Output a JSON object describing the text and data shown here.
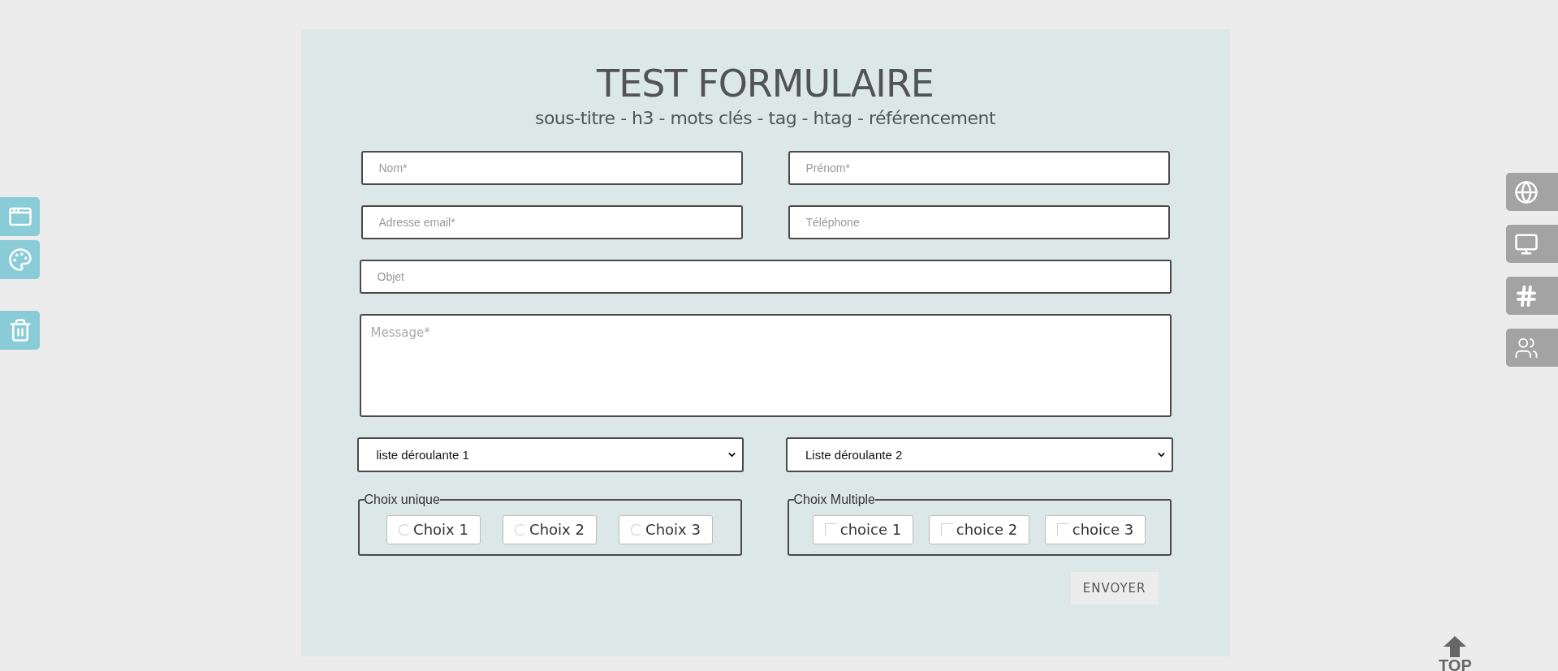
{
  "header": {
    "title": "TEST FORMULAIRE",
    "subtitle": "sous-titre - h3 - mots clés - tag - htag - référencement"
  },
  "field_rows": [
    [
      {
        "placeholder": "Nom*"
      },
      {
        "placeholder": "Prénom*"
      }
    ],
    [
      {
        "placeholder": "Adresse email*"
      },
      {
        "placeholder": "Téléphone"
      }
    ],
    [
      {
        "placeholder": "Objet"
      }
    ]
  ],
  "message": {
    "placeholder": "Message*"
  },
  "selects": [
    {
      "value": "liste déroulante 1"
    },
    {
      "value": "Liste déroulante 2"
    }
  ],
  "groups": [
    {
      "legend": "Choix unique",
      "kind": "radio",
      "options": [
        {
          "label": "Choix 1",
          "checked": false
        },
        {
          "label": "Choix 2",
          "checked": false
        },
        {
          "label": "Choix 3",
          "checked": false
        }
      ]
    },
    {
      "legend": "Choix Multiple",
      "kind": "checkbox",
      "options": [
        {
          "label": "choice 1",
          "checked": false
        },
        {
          "label": "choice 2",
          "checked": false
        },
        {
          "label": "choice 3",
          "checked": false
        }
      ]
    }
  ],
  "submit": {
    "label": "ENVOYER"
  },
  "back_to_top": {
    "label": "TOP"
  }
}
